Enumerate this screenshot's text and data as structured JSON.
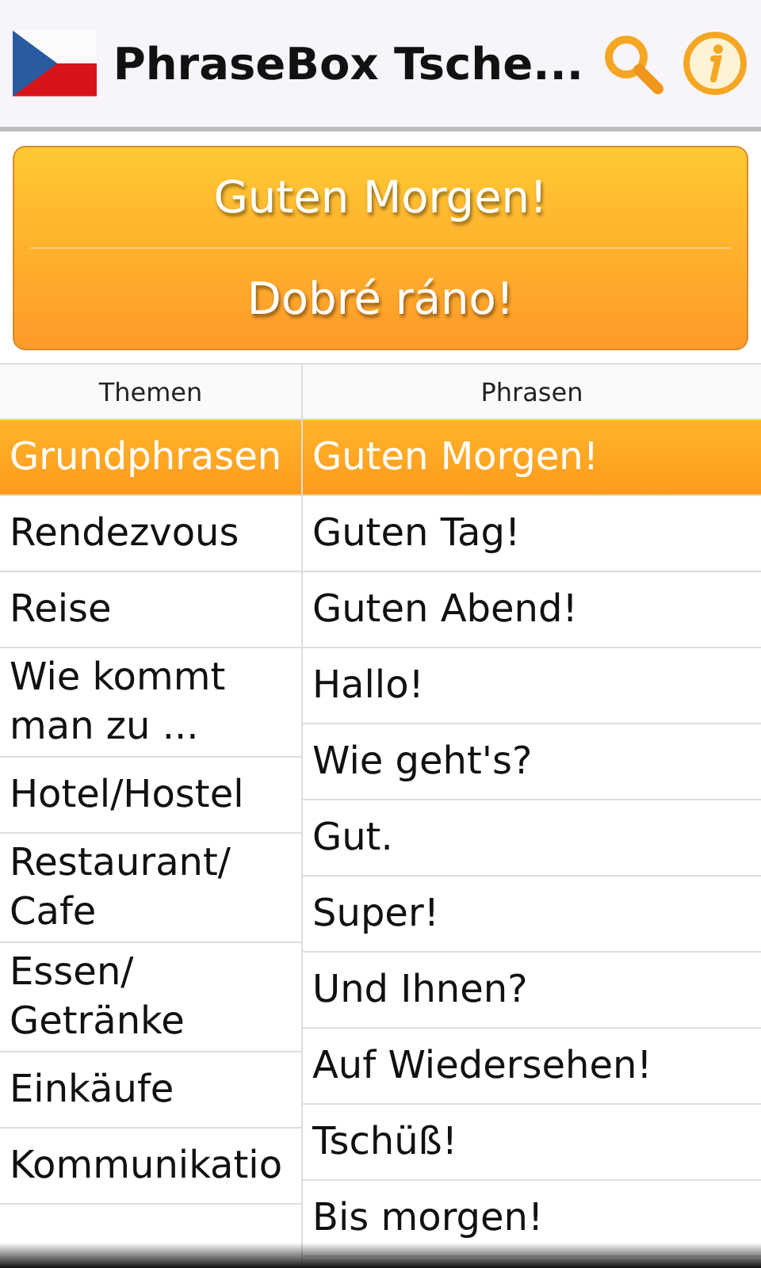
{
  "app_bar": {
    "title": "PhraseBox Tsche..."
  },
  "phrase_card": {
    "source": "Guten Morgen!",
    "translation": "Dobré ráno!"
  },
  "table": {
    "columns": [
      "Themen",
      "Phrasen"
    ],
    "topics": [
      {
        "label": "Grundphrasen",
        "selected": true
      },
      {
        "label": "Rendezvous",
        "selected": false
      },
      {
        "label": "Reise",
        "selected": false
      },
      {
        "label": "Wie kommt man zu ...",
        "selected": false
      },
      {
        "label": "Hotel/Hostel",
        "selected": false
      },
      {
        "label": "Restaurant/Cafe",
        "selected": false
      },
      {
        "label": "Essen/Getränke",
        "selected": false
      },
      {
        "label": "Einkäufe",
        "selected": false
      },
      {
        "label": "Kommunikatio",
        "selected": false
      }
    ],
    "phrases": [
      {
        "label": "Guten Morgen!",
        "selected": true
      },
      {
        "label": "Guten Tag!",
        "selected": false
      },
      {
        "label": "Guten Abend!",
        "selected": false
      },
      {
        "label": "Hallo!",
        "selected": false
      },
      {
        "label": "Wie geht's?",
        "selected": false
      },
      {
        "label": "Gut.",
        "selected": false
      },
      {
        "label": "Super!",
        "selected": false
      },
      {
        "label": "Und Ihnen?",
        "selected": false
      },
      {
        "label": "Auf Wiedersehen!",
        "selected": false
      },
      {
        "label": "Tschüß!",
        "selected": false
      },
      {
        "label": "Bis morgen!",
        "selected": false
      }
    ]
  }
}
